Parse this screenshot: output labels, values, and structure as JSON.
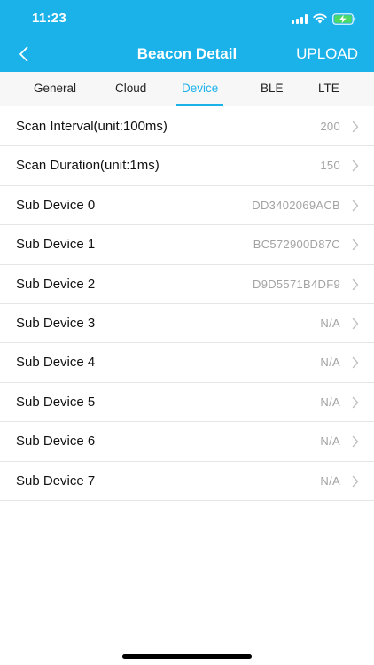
{
  "status_bar": {
    "time": "11:23"
  },
  "header": {
    "title": "Beacon Detail",
    "upload_label": "UPLOAD"
  },
  "colors": {
    "accent": "#1bb2ea",
    "battery_fill": "#4cd964"
  },
  "tabs": [
    {
      "label": "General"
    },
    {
      "label": "Cloud"
    },
    {
      "label": "Device",
      "active": true
    },
    {
      "label": "BLE"
    },
    {
      "label": "LTE"
    }
  ],
  "rows": [
    {
      "label": "Scan Interval(unit:100ms)",
      "value": "200"
    },
    {
      "label": "Scan Duration(unit:1ms)",
      "value": "150"
    },
    {
      "label": "Sub Device 0",
      "value": "DD3402069ACB"
    },
    {
      "label": "Sub Device 1",
      "value": "BC572900D87C"
    },
    {
      "label": "Sub Device 2",
      "value": "D9D5571B4DF9"
    },
    {
      "label": "Sub Device 3",
      "value": "N/A"
    },
    {
      "label": "Sub Device 4",
      "value": "N/A"
    },
    {
      "label": "Sub Device 5",
      "value": "N/A"
    },
    {
      "label": "Sub Device 6",
      "value": "N/A"
    },
    {
      "label": "Sub Device 7",
      "value": "N/A"
    }
  ]
}
